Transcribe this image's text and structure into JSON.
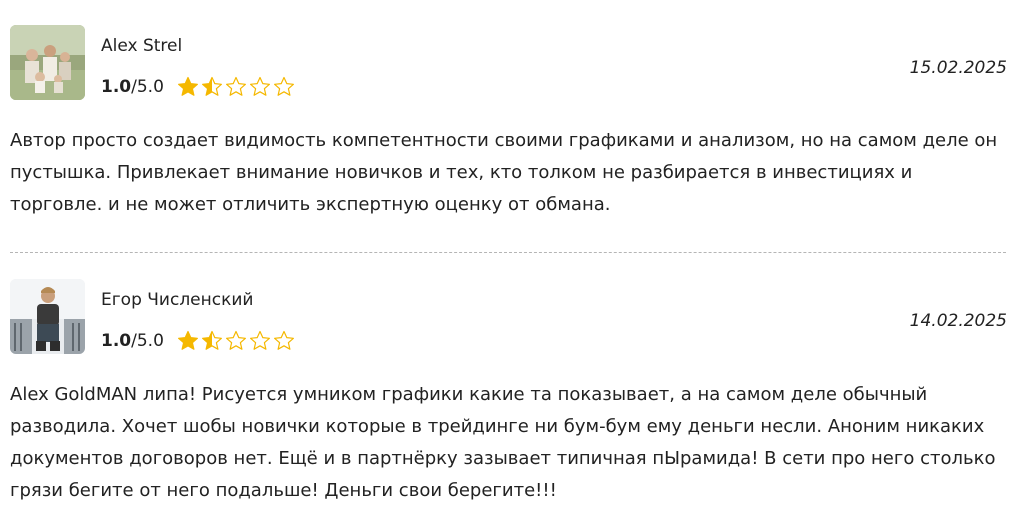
{
  "reviews": [
    {
      "author": "Alex Strel",
      "score": "1.0",
      "scale": "/5.0",
      "stars_filled": 1.5,
      "stars_total": 5,
      "date": "15.02.2025",
      "text": "Автор просто создает видимость компетентности своими графиками и анализом, но на самом деле он пустышка. Привлекает внимание новичков и тех, кто толком не разбирается в инвестициях и торговле. и не может отличить экспертную оценку от обмана."
    },
    {
      "author": "Егор Численский",
      "score": "1.0",
      "scale": "/5.0",
      "stars_filled": 1.5,
      "stars_total": 5,
      "date": "14.02.2025",
      "text": "Alex GoldMAN липа! Рисуется умником графики какие та показывает, а на самом деле обычный разводила. Хочет шобы новички которые в трейдинге ни бум-бум ему деньги несли. Аноним никаких документов договоров нет. Ещё и в партнёрку зазывает типичная пЫрамида! В сети про него столько грязи бегите от него подальше! Деньги свои берегите!!!"
    }
  ],
  "colors": {
    "star": "#f5b800",
    "star_outline": "#f5b800"
  }
}
